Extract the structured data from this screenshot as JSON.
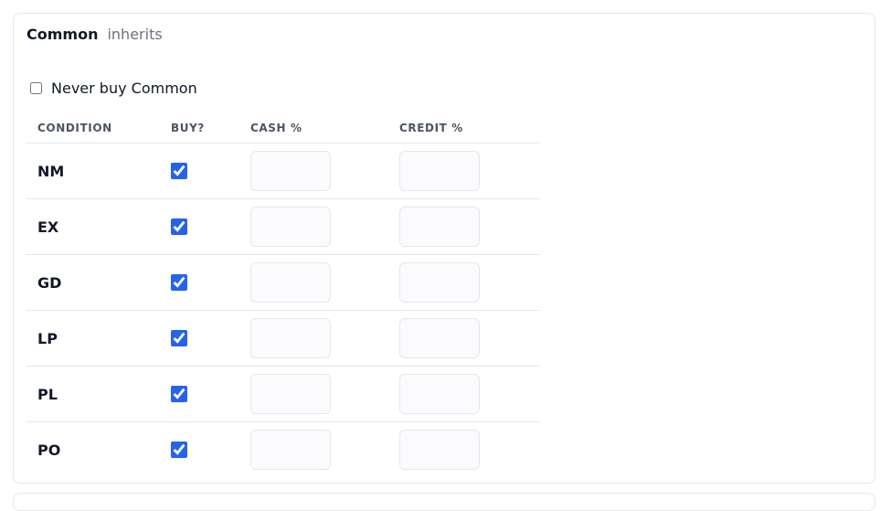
{
  "section": {
    "title": "Common",
    "note": "inherits"
  },
  "never_buy": {
    "label": "Never buy Common",
    "checked": false
  },
  "table": {
    "headers": {
      "condition": "CONDITION",
      "buy": "BUY?",
      "cash": "CASH %",
      "credit": "CREDIT %"
    },
    "rows": [
      {
        "condition": "NM",
        "buy": true,
        "cash": "",
        "credit": ""
      },
      {
        "condition": "EX",
        "buy": true,
        "cash": "",
        "credit": ""
      },
      {
        "condition": "GD",
        "buy": true,
        "cash": "",
        "credit": ""
      },
      {
        "condition": "LP",
        "buy": true,
        "cash": "",
        "credit": ""
      },
      {
        "condition": "PL",
        "buy": true,
        "cash": "",
        "credit": ""
      },
      {
        "condition": "PO",
        "buy": true,
        "cash": "",
        "credit": ""
      }
    ]
  },
  "colors": {
    "accent": "#2563eb",
    "border": "#e5e7eb",
    "muted": "#6b7280"
  }
}
